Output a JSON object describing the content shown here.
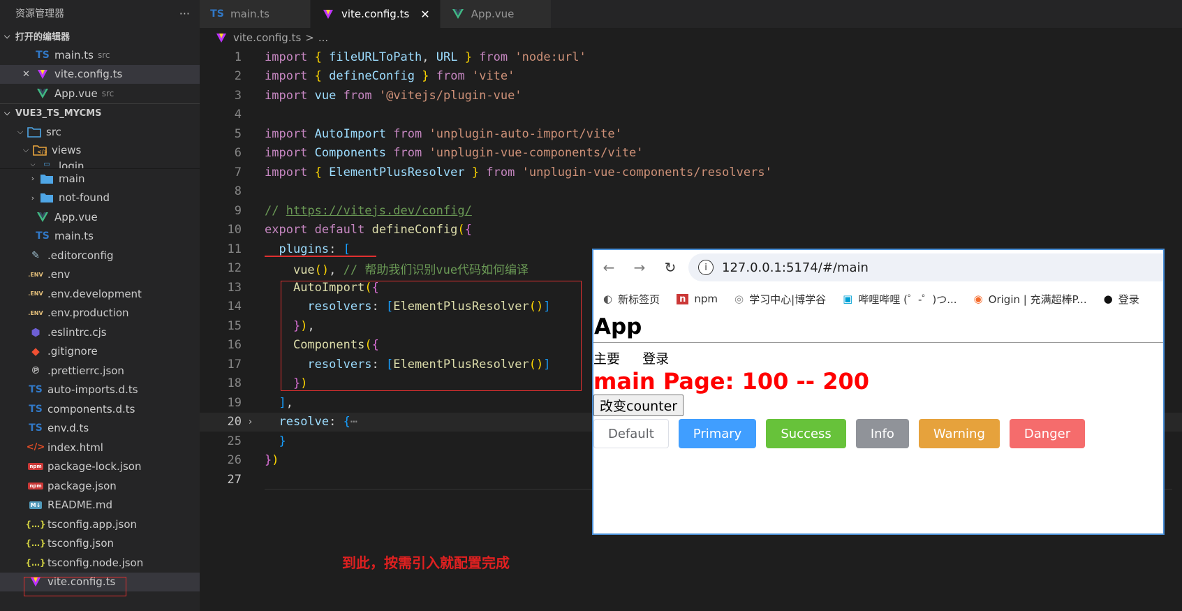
{
  "sidebar": {
    "title": "资源管理器",
    "more": "···",
    "open_editors_title": "打开的编辑器",
    "open_editors": [
      {
        "icon": "TS",
        "name": "main.ts",
        "hint": "src"
      },
      {
        "icon": "V",
        "name": "vite.config.ts",
        "hint": ""
      },
      {
        "icon": "V",
        "name": "App.vue",
        "hint": "src"
      }
    ],
    "close_glyph": "✕",
    "project_title": "VUE3_TS_MYCMS",
    "tree": {
      "src": "src",
      "views": "views",
      "login": "login",
      "main": "main",
      "not_found": "not-found",
      "app_vue": "App.vue",
      "main_ts": "main.ts",
      "editorconfig": ".editorconfig",
      "env": ".env",
      "env_dev": ".env.development",
      "env_prod": ".env.production",
      "eslintrc": ".eslintrc.cjs",
      "gitignore": ".gitignore",
      "prettierrc": ".prettierrc.json",
      "auto_imports": "auto-imports.d.ts",
      "components_d": "components.d.ts",
      "env_d": "env.d.ts",
      "index_html": "index.html",
      "package_lock": "package-lock.json",
      "package_json": "package.json",
      "readme": "README.md",
      "tsconfig_app": "tsconfig.app.json",
      "tsconfig": "tsconfig.json",
      "tsconfig_node": "tsconfig.node.json",
      "vite_config": "vite.config.ts"
    },
    "icons": {
      "ts": "TS",
      "env": ".ENV",
      "npm": "npm",
      "json": "{…}",
      "html": "</>",
      "md": "M↓"
    }
  },
  "tabs": [
    {
      "icon": "TS",
      "label": "main.ts",
      "active": false
    },
    {
      "icon": "V",
      "label": "vite.config.ts",
      "active": true,
      "close": "✕"
    },
    {
      "icon": "V",
      "label": "App.vue",
      "active": false
    }
  ],
  "breadcrumb": {
    "file": "vite.config.ts",
    "sep": ">",
    "rest": "..."
  },
  "editor": {
    "line_numbers": [
      "1",
      "2",
      "3",
      "4",
      "5",
      "6",
      "7",
      "8",
      "9",
      "10",
      "11",
      "12",
      "13",
      "14",
      "15",
      "16",
      "17",
      "18",
      "19",
      "20",
      "25",
      "26",
      "27"
    ],
    "tokens": {
      "import": "import",
      "from": "from",
      "export": "export",
      "default": "default",
      "fileURLToPath": "fileURLToPath",
      "URL": "URL",
      "node_url": "'node:url'",
      "defineConfig": "defineConfig",
      "vite": "'vite'",
      "vue": "vue",
      "plugin_vue": "'@vitejs/plugin-vue'",
      "AutoImport": "AutoImport",
      "auto_import_vite": "'unplugin-auto-import/vite'",
      "Components": "Components",
      "components_vite": "'unplugin-vue-components/vite'",
      "ElementPlusResolver": "ElementPlusResolver",
      "resolvers_pkg": "'unplugin-vue-components/resolvers'",
      "comment_prefix": "// ",
      "config_url": "https://vitejs.dev/config/",
      "plugins": "plugins",
      "comment_cn": "// 帮助我们识别vue代码如何编译",
      "resolvers": "resolvers",
      "resolve": "resolve",
      "ellipsis": "⋯"
    }
  },
  "note": "到此，按需引入就配置完成",
  "browser": {
    "back": "←",
    "forward": "→",
    "reload": "↻",
    "info": "i",
    "url": "127.0.0.1:5174/#/main",
    "bookmarks": [
      {
        "icon": "◐",
        "label": "新标签页"
      },
      {
        "icon": "n",
        "label": "npm"
      },
      {
        "icon": "◎",
        "label": "学习中心|博学谷"
      },
      {
        "icon": "▣",
        "label": "哔哩哔哩 (゜-゜)つ..."
      },
      {
        "icon": "◉",
        "label": "Origin | 充满超棒P..."
      },
      {
        "icon": "●",
        "label": "登录"
      }
    ],
    "app_title": "App",
    "nav_links": [
      "主要",
      "登录"
    ],
    "main_heading": "main Page: 100 -- 200",
    "counter_button": "改变counter",
    "buttons": [
      "Default",
      "Primary",
      "Success",
      "Info",
      "Warning",
      "Danger"
    ]
  }
}
